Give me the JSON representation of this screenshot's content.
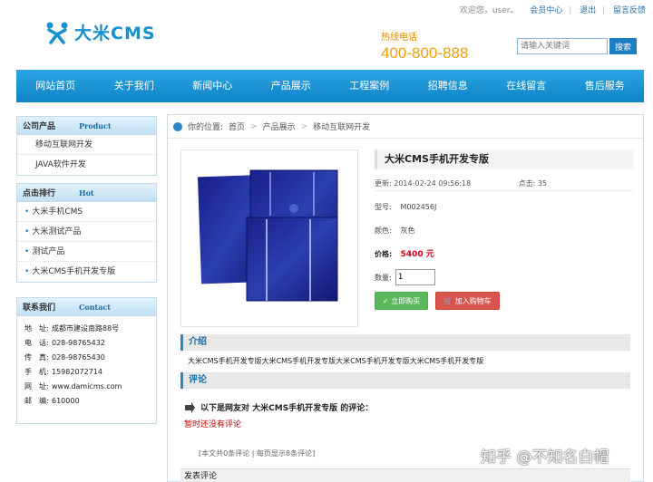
{
  "topbar": {
    "welcome": "欢迎您，user。",
    "member_center": "会员中心",
    "logout": "退出",
    "feedback": "留言反馈"
  },
  "header": {
    "logo_text": "大米CMS",
    "hotline_label": "热线电话",
    "hotline_number": "400-800-888",
    "search_placeholder": "请输入关键词",
    "search_button": "搜索"
  },
  "nav": [
    "网站首页",
    "关于我们",
    "新闻中心",
    "产品展示",
    "工程案例",
    "招聘信息",
    "在线留言",
    "售后服务"
  ],
  "sidebar": {
    "categories": {
      "title": "公司产品",
      "title_en": "Product",
      "items": [
        "移动互联网开发",
        "JAVA软件开发"
      ]
    },
    "hot": {
      "title": "点击排行",
      "title_en": "Hot",
      "items": [
        "大米手机CMS",
        "大米测试产品",
        "测试产品",
        "大米CMS手机开发专版"
      ]
    },
    "contact": {
      "title": "联系我们",
      "title_en": "Contact",
      "rows": [
        {
          "k": "地　址:",
          "v": "成都市建设南路88号"
        },
        {
          "k": "电　话:",
          "v": "028-98765432"
        },
        {
          "k": "传　真:",
          "v": "028-98765430"
        },
        {
          "k": "手　机:",
          "v": "15982072714"
        },
        {
          "k": "网　址:",
          "v": "www.damicms.com"
        },
        {
          "k": "邮　编:",
          "v": "610000"
        }
      ]
    }
  },
  "breadcrumb": {
    "label": "你的位置:",
    "items": [
      "首页",
      "产品展示",
      "移动互联网开发"
    ]
  },
  "product": {
    "title": "大米CMS手机开发专版",
    "updated": "更新: 2014-02-24 09:56:18",
    "clicks": "点击: 35",
    "model_label": "型号:",
    "model": "M002456J",
    "color_label": "颜色:",
    "color": "灰色",
    "price_label": "价格:",
    "price": "5400 元",
    "qty_label": "数量:",
    "qty": "1",
    "buy_button": "立即购买",
    "cart_button": "加入购物车"
  },
  "intro": {
    "heading": "介绍",
    "text": "大米CMS手机开发专版大米CMS手机开发专版大米CMS手机开发专版大米CMS手机开发专版"
  },
  "comments": {
    "heading": "评论",
    "title": "以下是网友对 大米CMS手机开发专版 的评论：",
    "empty": "暂时还没有评论",
    "pager": "[本文共0条评论 | 每页显示8条评论]",
    "post_heading": "发表评论"
  },
  "watermark": "知乎 @不知名白帽"
}
